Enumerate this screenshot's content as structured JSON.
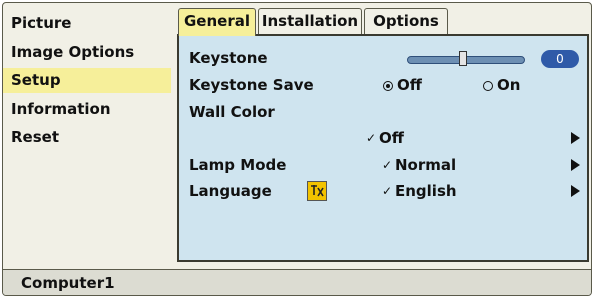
{
  "sidebar": {
    "items": [
      {
        "label": "Picture"
      },
      {
        "label": "Image Options"
      },
      {
        "label": "Setup"
      },
      {
        "label": "Information"
      },
      {
        "label": "Reset"
      }
    ]
  },
  "tabs": [
    {
      "label": "General"
    },
    {
      "label": "Installation"
    },
    {
      "label": "Options"
    }
  ],
  "settings": {
    "keystone": {
      "label": "Keystone",
      "value": "0"
    },
    "keystone_save": {
      "label": "Keystone Save",
      "off_label": "Off",
      "on_label": "On",
      "selected": "Off"
    },
    "wall_color": {
      "label": "Wall Color",
      "value": "Off"
    },
    "lamp_mode": {
      "label": "Lamp Mode",
      "value": "Normal"
    },
    "language": {
      "label": "Language",
      "value": "English"
    },
    "check_mark": "✓"
  },
  "status_bar": {
    "source": "Computer1"
  },
  "colors": {
    "background": "#f1f0e6",
    "highlight": "#f6ef9a",
    "panel": "#cfe4ef",
    "badge": "#2f5aa8"
  },
  "icons": {
    "submenu": "triangle-right-icon",
    "language": "language-icon"
  }
}
